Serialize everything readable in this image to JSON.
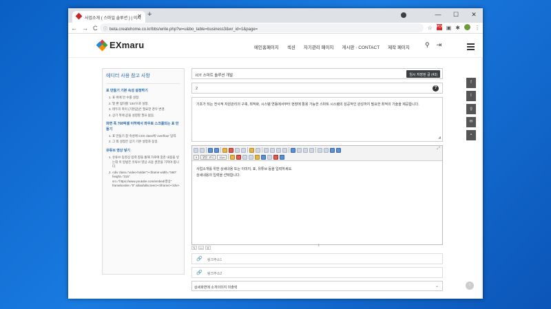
{
  "browser": {
    "tab_title": "사업소개 ( 스마일 솔루션 ) | 이지",
    "new_tab": "+",
    "window_controls": [
      "—",
      "☐",
      "✕"
    ],
    "url": "beta.createhome.co.kr/bbs/write.php?w=u&bo_table=business3&wr_id=1&page=",
    "nav": [
      "←",
      "→",
      "C"
    ],
    "icons": [
      "☆",
      "PDF",
      "⋮"
    ]
  },
  "site": {
    "logo": "EXmaru",
    "menu": [
      "메인홈페이지",
      "섹션",
      "자기관리 페이지",
      "게시판 · CONTACT",
      "제작 페이지"
    ]
  },
  "guide": {
    "title": "에디터 사용 참고 사항",
    "sections": [
      {
        "heading": "표 만들기 기본 속성 설정하기",
        "items": [
          "표 위에 먼 수를 설정.",
          "열 편 넓이를 '100'으로 설정.",
          "테두리 폭이 (기본값)은 필요한 경우 변경.",
          "상기 폭에 값을 설정할 필요 없음."
        ]
      },
      {
        "heading": "화면 폭 768픽셀 이하에서 좌우로 스크롤되는 표 만들기",
        "items": [
          "표 만들기 창 속성에 CSS class에 'overflow' 입력.",
          "그 외 설정은 상기 기본 설정과 동일."
        ]
      },
      {
        "heading": "유튜브 영상 넣기",
        "items": [
          "유튜브 동영상 입력 창을 통해 가로에 맞춘 내용을 넣는데 이 방법은 유튜브 영상 사용 권한을 가져야 합니다.",
          "<div class=\"video-holder\"><iframe width=\"560\" height=\"315\" src=\"https://www.youtube.com/embed/영상\" frameborder=\"0\" allowfullscreen></iframe></div>"
        ]
      }
    ]
  },
  "form": {
    "subject": "IOT 스마트 솔루션 개발",
    "save_button": "임시 저장된 글 (43)",
    "order": "2",
    "help": "?",
    "summary": "기초가 되는 전사적 자원관리의 구축, 최적화, 시스템 연동에서부터 현장에 활용 가능한 스마트 시스템의 성공적인 완성까지 필요한 최적의 기술을 제공합니다.",
    "editor_font": "9",
    "editor_font_name": "맑은 고딕",
    "editor_size": "12pt",
    "editor_body_line1": "사업소개를 위한 상세내용 또는 이미지, 표, 유튜브 등을 입력하세요.",
    "editor_body_line2": "상세내용의 입력을 선택합니다.",
    "link1": "링크주소1",
    "link2": "링크주소2",
    "select_value": "상세화면에 소개이미지 미출력"
  },
  "share": [
    "f",
    "t",
    "g",
    "✉",
    "▪"
  ],
  "top_button": "↑"
}
